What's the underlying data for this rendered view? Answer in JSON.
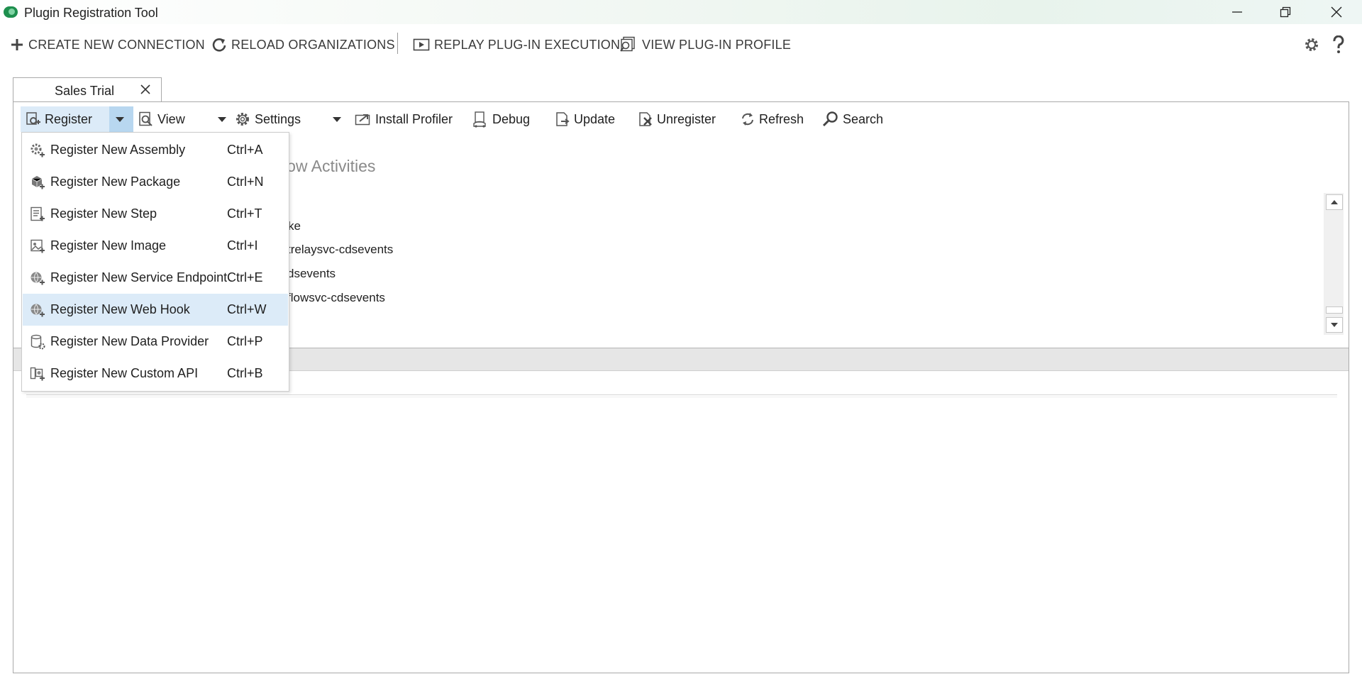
{
  "window": {
    "title": "Plugin Registration Tool"
  },
  "top_toolbar": {
    "create": "CREATE NEW CONNECTION",
    "reload": "RELOAD ORGANIZATIONS",
    "replay": "REPLAY PLUG-IN EXECUTION",
    "view_profile": "VIEW PLUG-IN PROFILE"
  },
  "tab": {
    "label": "Sales Trial"
  },
  "ribbon": {
    "register": "Register",
    "view": "View",
    "settings": "Settings",
    "install_profiler": "Install Profiler",
    "debug": "Debug",
    "update": "Update",
    "unregister": "Unregister",
    "refresh": "Refresh",
    "search": "Search"
  },
  "tree": {
    "header_fragment": "low Activities",
    "items": [
      "ke",
      "trelaysvc-cdsevents",
      "dsevents",
      "flowsvc-cdsevents"
    ]
  },
  "register_menu": {
    "items": [
      {
        "label": "Register New Assembly",
        "shortcut": "Ctrl+A",
        "icon": "assembly-icon"
      },
      {
        "label": "Register New Package",
        "shortcut": "Ctrl+N",
        "icon": "package-icon"
      },
      {
        "label": "Register New Step",
        "shortcut": "Ctrl+T",
        "icon": "step-icon"
      },
      {
        "label": "Register New Image",
        "shortcut": "Ctrl+I",
        "icon": "image-icon"
      },
      {
        "label": "Register New Service Endpoint",
        "shortcut": "Ctrl+E",
        "icon": "service-endpoint-icon"
      },
      {
        "label": "Register New Web Hook",
        "shortcut": "Ctrl+W",
        "icon": "web-hook-icon",
        "highlighted": true
      },
      {
        "label": "Register New Data Provider",
        "shortcut": "Ctrl+P",
        "icon": "data-provider-icon"
      },
      {
        "label": "Register New Custom API",
        "shortcut": "Ctrl+B",
        "icon": "custom-api-icon"
      }
    ]
  },
  "colors": {
    "highlight": "#dcebf8",
    "dropdown_accent": "#b8d7f0",
    "brand": "#1e8f4e"
  }
}
